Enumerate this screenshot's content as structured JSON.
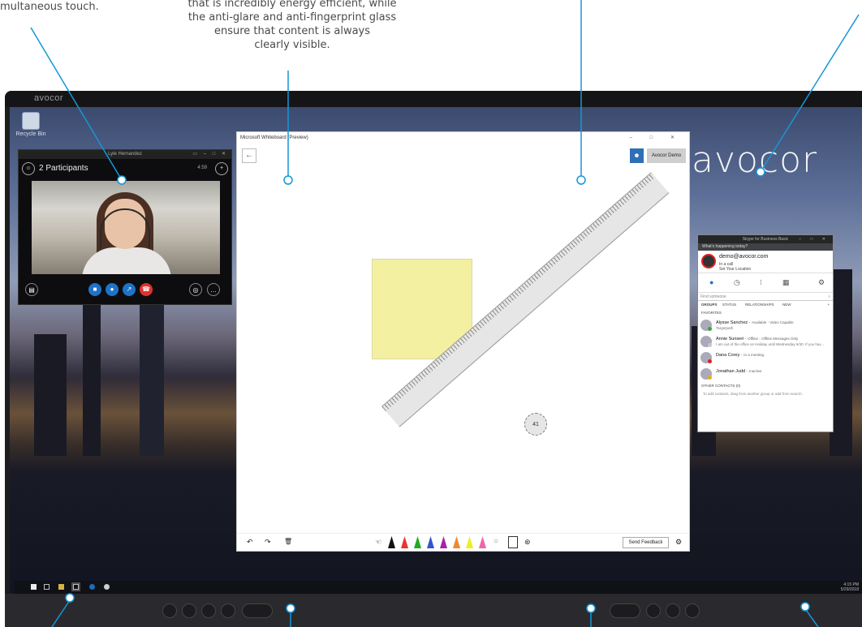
{
  "callouts": {
    "left_fragment": "multaneous touch.",
    "center_line1": "that is incredibly energy efficient, while",
    "center_line2": "the anti-glare and anti-fingerprint glass",
    "center_line3": "ensure that content is always",
    "center_line4": "clearly visible."
  },
  "monitor": {
    "brand": "avocor"
  },
  "desktop": {
    "recycle_label": "Recycle Bin",
    "logo": "avocor"
  },
  "video_call": {
    "title": "Lyle Hernandez",
    "participants_label": "2 Participants",
    "signal": "4:59"
  },
  "whiteboard": {
    "title": "Microsoft Whiteboard (Preview)",
    "user_label": "Avocor Demo",
    "ruler_angle": "41",
    "send_feedback": "Send Feedback",
    "back_icon": "←"
  },
  "skype": {
    "title": "Skype for Business Basic",
    "whats_happening": "What's happening today?",
    "email": "demo@avocor.com",
    "status": "In a call",
    "location": "Set Your Location",
    "find_placeholder": "Find someone",
    "tabs": [
      "GROUPS",
      "STATUS",
      "RELATIONSHIPS",
      "NEW"
    ],
    "favorites_label": "FAVORITES",
    "contacts": [
      {
        "name": "Alysse Sanchez",
        "status": "Available - Video Capable",
        "note": "Targetpath",
        "dot": "#3aa53a"
      },
      {
        "name": "Annie Sunseri",
        "status": "Offline - Offline Messages Only",
        "note": "I am out of the office on Holiday until Wednesday 6/30. If you hav...",
        "dot": "#c6c6c6"
      },
      {
        "name": "Dana Corey",
        "status": "In a meeting",
        "note": "",
        "dot": "#d22"
      },
      {
        "name": "Jonathan Judd",
        "status": "Inactive",
        "note": "",
        "dot": "#e0b020"
      }
    ],
    "other_contacts_label": "OTHER CONTACTS (0)",
    "other_contacts_hint": "To add contacts, drag from another group or add from search."
  },
  "taskbar": {
    "time": "4:15 PM",
    "date": "5/29/2018"
  },
  "colors": {
    "accent": "#0f8fd6",
    "skype_blue": "#1e73c8",
    "end_call": "#e0322f"
  }
}
